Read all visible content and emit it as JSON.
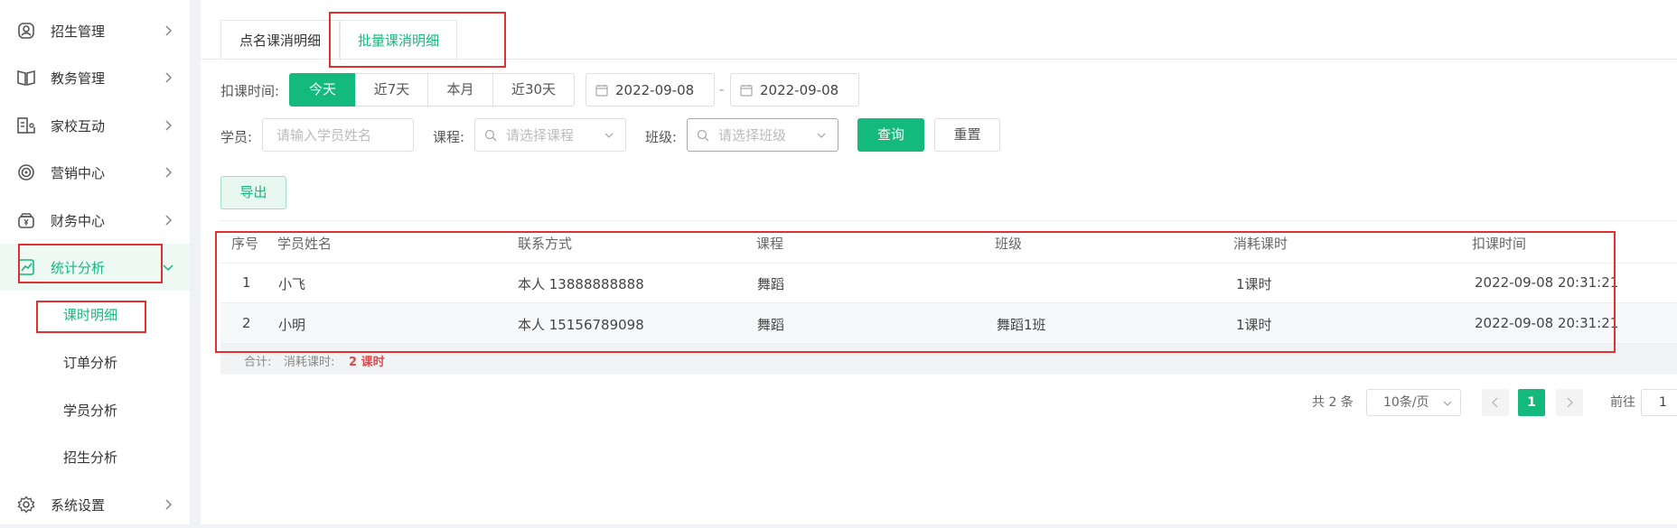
{
  "sidebar": {
    "items": [
      {
        "label": "招生管理",
        "icon": "user-badge-icon"
      },
      {
        "label": "教务管理",
        "icon": "book-icon"
      },
      {
        "label": "家校互动",
        "icon": "home-school-icon"
      },
      {
        "label": "营销中心",
        "icon": "target-icon"
      },
      {
        "label": "财务中心",
        "icon": "wallet-icon"
      },
      {
        "label": "统计分析",
        "icon": "chart-icon"
      },
      {
        "label": "系统设置",
        "icon": "gear-icon"
      }
    ],
    "subitems": [
      "课时明细",
      "订单分析",
      "学员分析",
      "招生分析"
    ]
  },
  "tabs": [
    "点名课消明细",
    "批量课消明细"
  ],
  "filters": {
    "time_label": "扣课时间:",
    "segments": [
      "今天",
      "近7天",
      "本月",
      "近30天"
    ],
    "date_start": "2022-09-08",
    "date_sep": "-",
    "date_end": "2022-09-08",
    "student_label": "学员:",
    "student_placeholder": "请输入学员姓名",
    "course_label": "课程:",
    "course_placeholder": "请选择课程",
    "class_label": "班级:",
    "class_placeholder": "请选择班级",
    "query": "查询",
    "reset": "重置",
    "export": "导出"
  },
  "table": {
    "headers": [
      "序号",
      "学员姓名",
      "联系方式",
      "课程",
      "班级",
      "消耗课时",
      "扣课时间"
    ],
    "rows": [
      [
        "1",
        "小飞",
        "本人 13888888888",
        "舞蹈",
        "",
        "1课时",
        "2022-09-08 20:31:21"
      ],
      [
        "2",
        "小明",
        "本人 15156789098",
        "舞蹈",
        "舞蹈1班",
        "1课时",
        "2022-09-08 20:31:21"
      ]
    ],
    "summary_label": "合计:",
    "summary_consumed_label": "消耗课时:",
    "summary_value": "2 课时"
  },
  "pagination": {
    "total": "共 2 条",
    "page_size": "10条/页",
    "current": "1",
    "goto_label": "前往",
    "goto_value": "1"
  },
  "colors": {
    "accent": "#13b97d",
    "highlight": "#e03030",
    "summary_value": "#e04848"
  }
}
